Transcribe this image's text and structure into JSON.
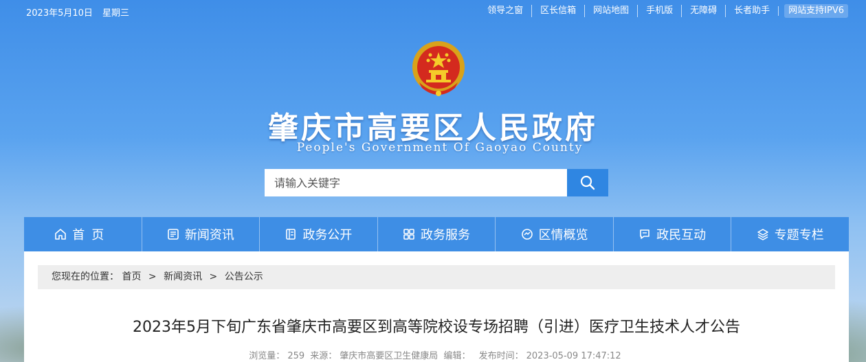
{
  "topbar": {
    "date": "2023年5月10日",
    "weekday": "星期三",
    "links": [
      "领导之窗",
      "区长信箱",
      "网站地图",
      "手机版",
      "无障碍",
      "长者助手"
    ],
    "ipv6": "网站支持IPV6"
  },
  "header": {
    "emblem_icon": "national-emblem-icon",
    "title": "肇庆市高要区人民政府",
    "subtitle": "People's Government Of Gaoyao County"
  },
  "search": {
    "placeholder": "请输入关键字",
    "value": "",
    "icon": "search-icon"
  },
  "nav": {
    "items": [
      {
        "label": "首页",
        "icon": "home-icon"
      },
      {
        "label": "新闻资讯",
        "icon": "news-icon"
      },
      {
        "label": "政务公开",
        "icon": "document-icon"
      },
      {
        "label": "政务服务",
        "icon": "grid-icon"
      },
      {
        "label": "区情概览",
        "icon": "compass-icon"
      },
      {
        "label": "政民互动",
        "icon": "chat-icon"
      },
      {
        "label": "专题专栏",
        "icon": "layers-icon"
      }
    ]
  },
  "breadcrumb": {
    "prefix": "您现在的位置：",
    "items": [
      "首页",
      "新闻资讯",
      "公告公示"
    ],
    "separator": ">"
  },
  "article": {
    "title": "2023年5月下旬广东省肇庆市高要区到高等院校设专场招聘（引进）医疗卫生技术人才公告",
    "views_label": "浏览量：",
    "views": "259",
    "source_label": "来源：",
    "source": "肇庆市高要区卫生健康局",
    "editor_label": "编辑：",
    "editor": "",
    "published_label": "发布时间：",
    "published": "2023-05-09 17:47:12"
  },
  "colors": {
    "nav_bg": "#3e8ee5",
    "search_button": "#2f86e2",
    "breadcrumb_bg": "#eeeeee"
  }
}
